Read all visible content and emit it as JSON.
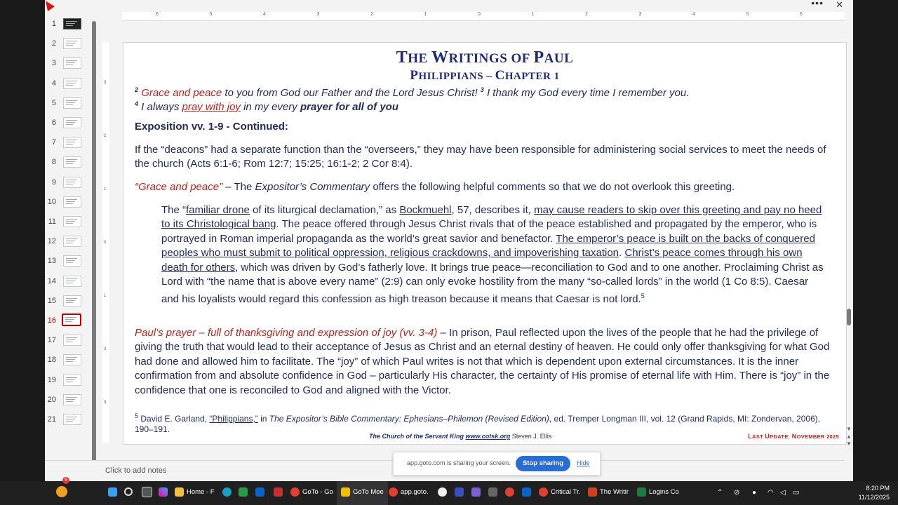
{
  "window": {
    "more_label": "•••",
    "close_label": "✕"
  },
  "thumbnails": [
    "1",
    "2",
    "3",
    "4",
    "5",
    "6",
    "7",
    "8",
    "9",
    "10",
    "11",
    "12",
    "13",
    "14",
    "15",
    "16",
    "17",
    "18",
    "19",
    "20",
    "21"
  ],
  "active_slide": "16",
  "ruler_h": [
    "6",
    "5",
    "4",
    "3",
    "2",
    "1",
    "0",
    "1",
    "2",
    "3",
    "4",
    "5",
    "6"
  ],
  "ruler_v": [
    "3",
    "2",
    "1",
    "0",
    "1",
    "2",
    "3"
  ],
  "slide": {
    "title": "The Writings of Paul",
    "subtitle": "Philippians – Chapter 1",
    "verse": {
      "v2_num": "2",
      "v2_phrase": "Grace and peace",
      "v2_text": " to you from God our Father and the Lord Jesus Christ! ",
      "v3_num": "3",
      "v3_text": " I thank my God every time I remember you.",
      "v4_num": "4",
      "v4_text_a": " I always ",
      "v4_link": "pray with joy",
      "v4_text_b": " in my every ",
      "v4_bold": "prayer for all of you"
    },
    "exposition_heading": "Exposition vv. 1-9 - Continued:",
    "para1": "If the “deacons” had a separate function than the “overseers,” they may have been responsible for administering social services to meet the needs of the church (Acts 6:1-6; Rom 12:7; 15:25; 16:1-2; 2 Cor 8:4).",
    "para2": {
      "phrase": "“Grace and peace”",
      "text_a": " – The ",
      "book": "Expositor’s Commentary",
      "text_b": " offers the following helpful comments so that we do not overlook this greeting."
    },
    "quote": {
      "t1": "The “",
      "u1": "familiar drone",
      "t2": " of its liturgical declamation,” as ",
      "u2": "Bockmuehl",
      "t3": ", 57, describes it, ",
      "u3": "may cause readers to skip over this greeting and pay no heed to its Christological bang",
      "t4": ". The peace offered through Jesus Christ rivals that of the peace established and propagated by the emperor, who is portrayed in Roman imperial propaganda as the world’s great savior and benefactor. ",
      "u4": "The emperor’s peace is built on the backs of conquered peoples who must submit to political oppression, religious crackdowns, and impoverishing taxation",
      "t5": ". ",
      "u5": "Christ’s peace comes through his own death for others",
      "t6": ", which was driven by God’s fatherly love. It brings true peace—reconciliation to God and to one another. Proclaiming Christ as Lord with “the name that is above every name” (2:9) can only evoke hostility from the many “so-called lords” in the world (1 Co 8:5). Caesar and his loyalists would regard this confession as high treason because it means that Caesar is not lord.",
      "fn": "5"
    },
    "para3": {
      "phrase": "Paul’s prayer – full of thanksgiving and expression of joy (vv. 3-4)",
      "text": " – In prison, Paul reflected upon the lives of the people that he had the privilege of giving the truth that would lead to their acceptance of Jesus as Christ and an eternal destiny of heaven.  He could only offer thanksgiving for what God had done and allowed him to facilitate.  The “joy” of which Paul writes is not that which is dependent upon external circumstances.  It is the inner confirmation from and absolute confidence in God – particularly His character, the certainty of His promise of eternal life with Him.  There is “joy” in the confidence that one is reconciled to God and aligned with the Victor."
    },
    "footnote": {
      "num": "5",
      "a": " David E. Garland, ",
      "link": "“Philippians,”",
      "b": " in ",
      "book": "The Expositor’s Bible Commentary: Ephesians–Philemon (Revised Edition)",
      "c": ", ed. Tremper Longman III, vol. 12 (Grand Rapids, MI: Zondervan, 2006), 190–191."
    },
    "footer_left_church": "The Church of the Servant King",
    "footer_left_url": "www.cotsk.org",
    "footer_left_author": " Steven J. Ellis",
    "footer_right": "Last Update: November 2025"
  },
  "notes_placeholder": "Click to add notes",
  "share_bar": {
    "message": "app.goto.com is sharing your screen.",
    "stop_label": "Stop sharing",
    "hide_label": "Hide"
  },
  "taskbar": {
    "badge": "9",
    "items": [
      "Home - F",
      "GoTo - Go",
      "GoTo Mee",
      "app.goto.",
      "Critical Tr.",
      "The Writir",
      "Logins Co"
    ],
    "time": "8:20 PM",
    "date": "11/12/2025"
  },
  "colors": {
    "title_blue": "#1f2a7a",
    "accent_red": "#c0201a",
    "share_blue": "#2a6cd6",
    "taskbar": "#202020"
  }
}
